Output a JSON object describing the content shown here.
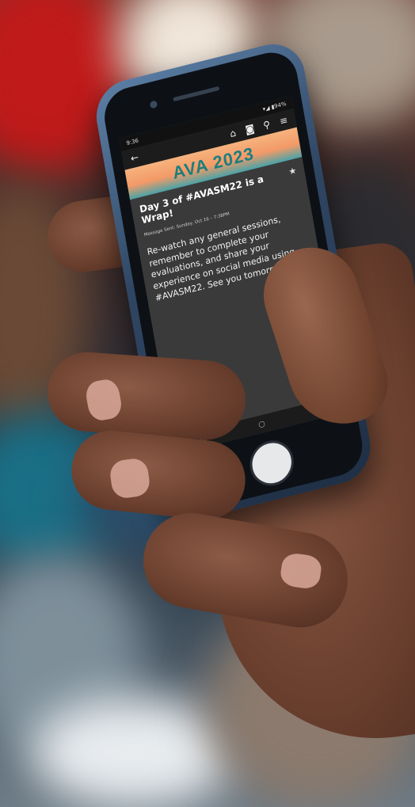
{
  "phone_app": {
    "status": {
      "time": "9:36",
      "indicators": "▾◢ ▮94%"
    },
    "app_bar": {
      "back_icon": "arrow-left-icon",
      "icons": [
        "home-icon",
        "camera-icon",
        "search-icon",
        "menu-icon"
      ]
    },
    "banner": {
      "logo_text": "AVA 2023"
    },
    "message": {
      "title": "Day 3 of #AVASM22 is a Wrap!",
      "meta": "Message Sent: Sunday, Oct 16 – 7:38PM",
      "body": "Re-watch any general sessions, remember to complete your evaluations, and share your experience on social media using #AVASM22. See you tomorrow!"
    },
    "nav_bar": {
      "icons": [
        "recent-apps-icon",
        "home-circle-icon",
        "back-chevron-icon"
      ]
    }
  },
  "colors": {
    "banner_orange": "#f39a67",
    "banner_teal": "#1a7f7f",
    "screen_bg": "#3a3a3a",
    "phone_body": "#2f4663"
  }
}
